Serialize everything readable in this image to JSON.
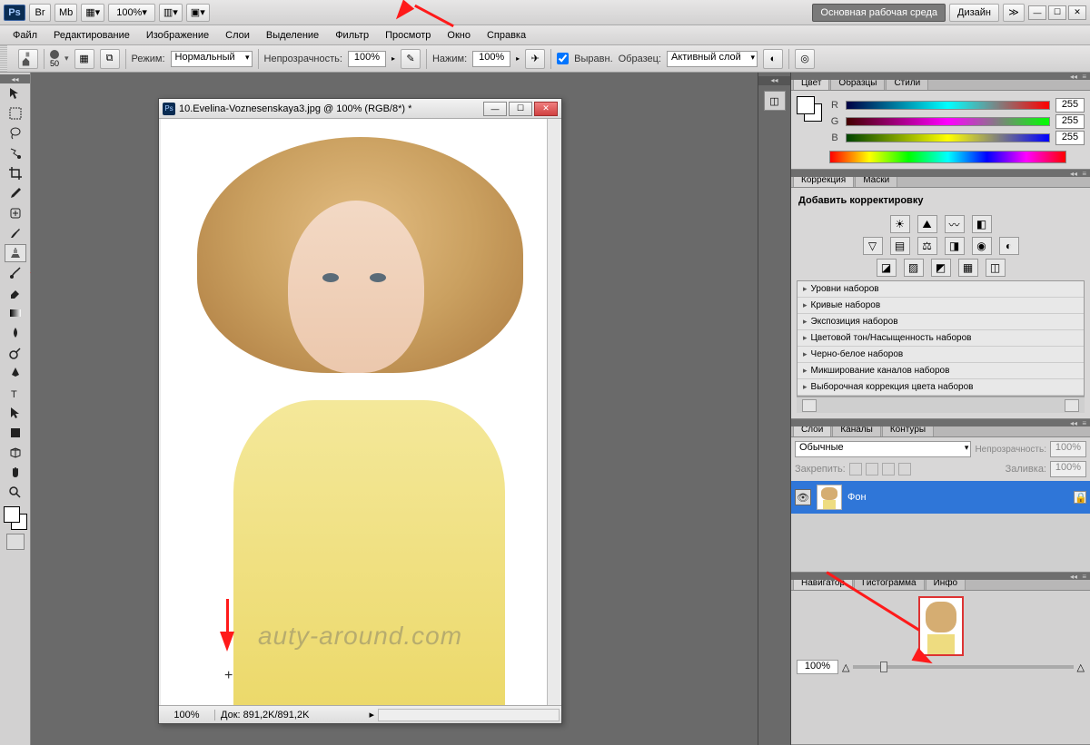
{
  "app": {
    "zoom_display": "100%",
    "workspace_btn": "Основная рабочая среда",
    "design_btn": "Дизайн"
  },
  "menu": {
    "items": [
      "Файл",
      "Редактирование",
      "Изображение",
      "Слои",
      "Выделение",
      "Фильтр",
      "Просмотр",
      "Окно",
      "Справка"
    ]
  },
  "options": {
    "brush_size": "50",
    "mode_label": "Режим:",
    "mode_value": "Нормальный",
    "opacity_label": "Непрозрачность:",
    "opacity_value": "100%",
    "flow_label": "Нажим:",
    "flow_value": "100%",
    "aligned_label": "Выравн.",
    "sample_label": "Образец:",
    "sample_value": "Активный слой"
  },
  "document": {
    "title": "10.Evelina-Voznesenskaya3.jpg @ 100% (RGB/8*) *",
    "status_zoom": "100%",
    "status_doc": "Док: 891,2K/891,2K",
    "watermark": "auty-around.com"
  },
  "panels": {
    "color": {
      "tabs": [
        "Цвет",
        "Образцы",
        "Стили"
      ],
      "r_label": "R",
      "g_label": "G",
      "b_label": "B",
      "r_value": "255",
      "g_value": "255",
      "b_value": "255"
    },
    "adjustments": {
      "tabs": [
        "Коррекция",
        "Маски"
      ],
      "add_label": "Добавить корректировку",
      "presets": [
        "Уровни наборов",
        "Кривые наборов",
        "Экспозиция наборов",
        "Цветовой тон/Насыщенность наборов",
        "Черно-белое наборов",
        "Микширование каналов наборов",
        "Выборочная коррекция цвета наборов"
      ]
    },
    "layers": {
      "tabs": [
        "Слои",
        "Каналы",
        "Контуры"
      ],
      "blend_mode": "Обычные",
      "opacity_label": "Непрозрачность:",
      "opacity_value": "100%",
      "lock_label": "Закрепить:",
      "fill_label": "Заливка:",
      "fill_value": "100%",
      "layer_name": "Фон"
    },
    "navigator": {
      "tabs": [
        "Навигатор",
        "Гистограмма",
        "Инфо"
      ],
      "zoom": "100%"
    }
  }
}
